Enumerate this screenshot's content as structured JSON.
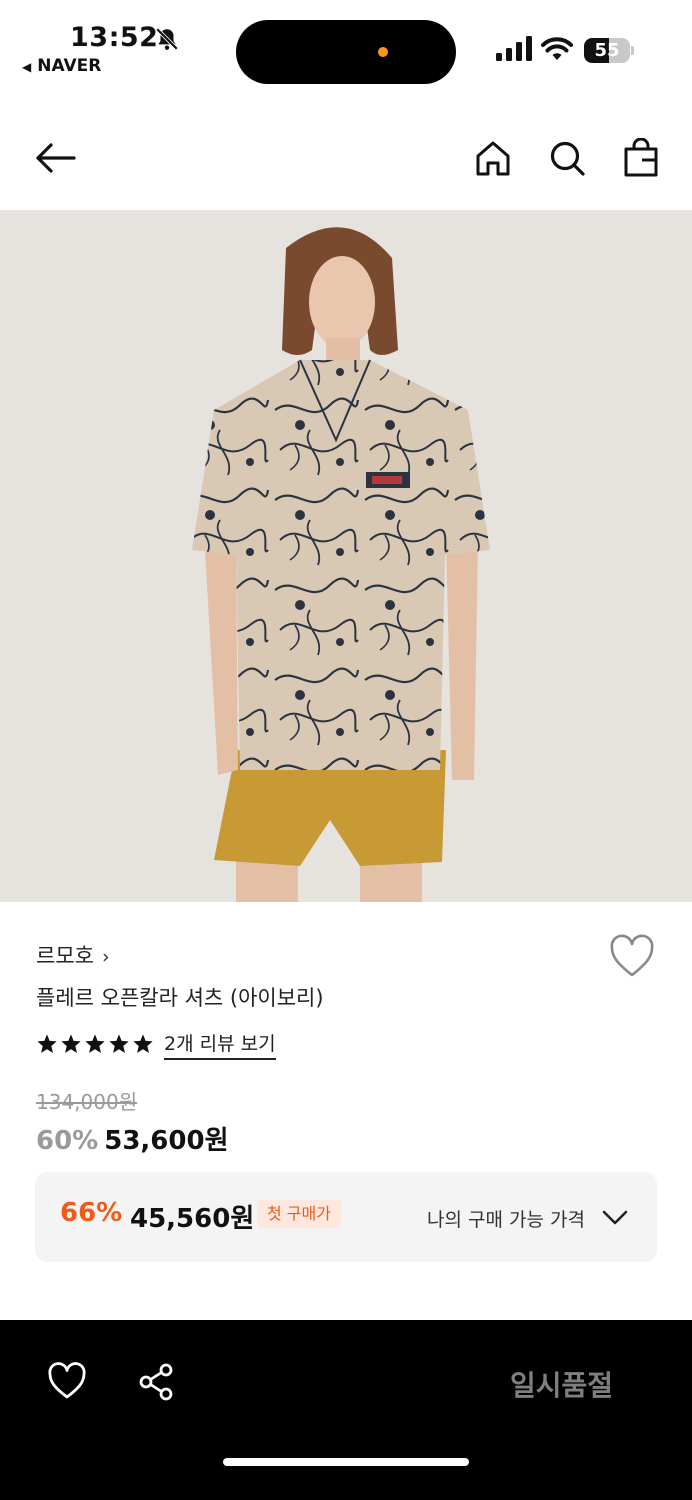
{
  "status_bar": {
    "time": "13:52",
    "back_app": "NAVER",
    "battery": "55",
    "battery_level": 0.55
  },
  "header": {
    "icons": [
      "back-arrow-icon",
      "home-icon",
      "search-icon",
      "shopping-bag-icon"
    ]
  },
  "product": {
    "brand": "르모호",
    "brand_chevron": "›",
    "name": "플레르 오픈칼라 셔츠 (아이보리)",
    "rating": 5,
    "review_link": "2개 리뷰 보기",
    "original_price": "134,000원",
    "discount": "60%",
    "price": "53,600원"
  },
  "my_price": {
    "discount": "66%",
    "price": "45,560원",
    "badge": "첫 구매가",
    "label": "나의 구매 가능 가격"
  },
  "bottom_bar": {
    "status": "일시품절"
  },
  "colors": {
    "accent": "#f25a19",
    "badge_bg": "#fde7de",
    "muted": "#9a9a9a",
    "bottom_bar_bg": "#000000"
  }
}
